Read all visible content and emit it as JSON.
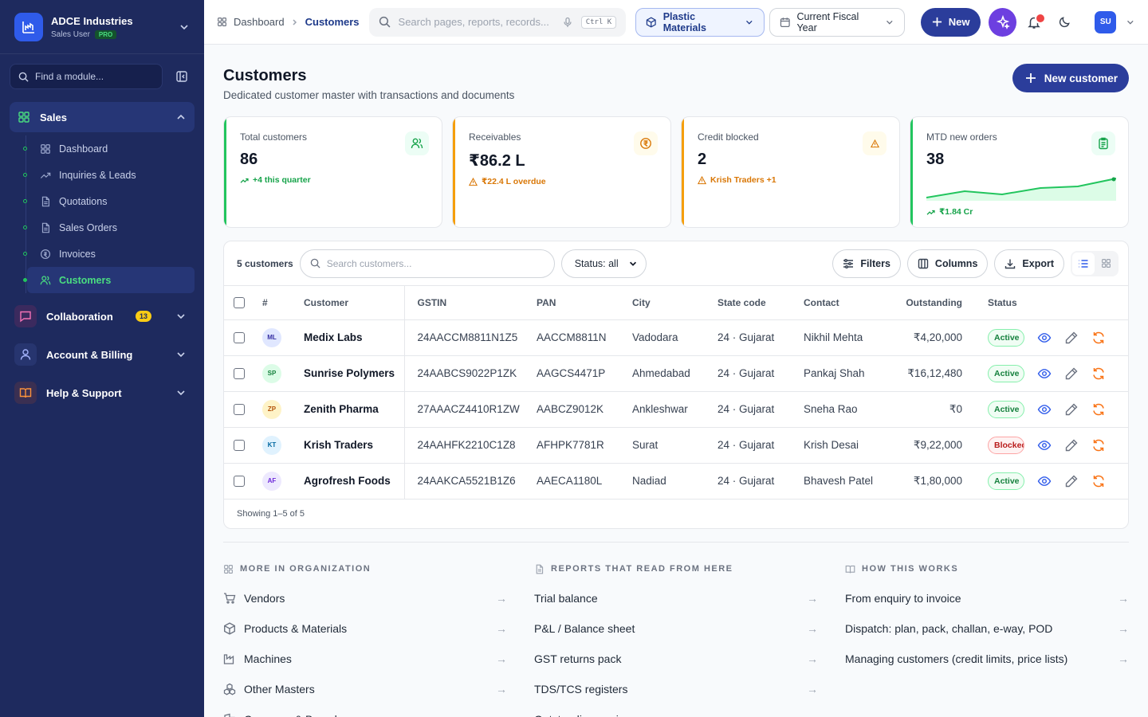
{
  "brand": {
    "name": "ADCE Industries",
    "role": "Sales User",
    "plan": "PRO"
  },
  "sidebar": {
    "find_placeholder": "Find a module...",
    "sales_label": "Sales",
    "sales_items": [
      {
        "label": "Dashboard",
        "icon": "grid-icon"
      },
      {
        "label": "Inquiries & Leads",
        "icon": "trend-icon"
      },
      {
        "label": "Quotations",
        "icon": "doc-icon"
      },
      {
        "label": "Sales Orders",
        "icon": "doc-icon"
      },
      {
        "label": "Invoices",
        "icon": "coin-icon"
      },
      {
        "label": "Customers",
        "icon": "users-icon"
      }
    ],
    "groups": [
      {
        "label": "Collaboration",
        "badge": "13"
      },
      {
        "label": "Account & Billing",
        "badge": ""
      },
      {
        "label": "Help & Support",
        "badge": ""
      }
    ]
  },
  "topbar": {
    "crumb_root": "Dashboard",
    "crumb_current": "Customers",
    "search_placeholder": "Search pages, reports, records...",
    "shortcut": "Ctrl K",
    "org_filter": "Plastic Materials",
    "period": "Current Fiscal Year",
    "new_label": "New",
    "user_initials": "SU"
  },
  "page": {
    "title": "Customers",
    "subtitle": "Dedicated customer master with transactions and documents",
    "new_button": "New customer"
  },
  "stats": [
    {
      "label": "Total customers",
      "value": "86",
      "note": "+4 this quarter",
      "accent": "#22c55e"
    },
    {
      "label": "Receivables",
      "value": "₹86.2 L",
      "note": "₹22.4 L overdue",
      "accent": "#f59e0b"
    },
    {
      "label": "Credit blocked",
      "value": "2",
      "note": "Krish Traders +1",
      "accent": "#f59e0b"
    },
    {
      "label": "MTD new orders",
      "value": "38",
      "note": "₹1.84 Cr",
      "accent": "#22c55e"
    }
  ],
  "table": {
    "count": "5 customers",
    "search_placeholder": "Search customers...",
    "status_filter": "Status: all",
    "filters": "Filters",
    "columns": "Columns",
    "export": "Export",
    "headers": [
      "#",
      "Customer",
      "GSTIN",
      "PAN",
      "City",
      "State code",
      "Contact",
      "Outstanding",
      "Status"
    ],
    "rows": [
      {
        "initials": "ML",
        "name": "Medix Labs",
        "gstin": "24AACCM8811N1Z5",
        "pan": "AACCM8811N",
        "city": "Vadodara",
        "state": "24 · Gujarat",
        "contact": "Nikhil Mehta",
        "outstanding": "₹4,20,000",
        "status": "Active",
        "av_bg": "#e0e7ff",
        "av_fg": "#3730a3"
      },
      {
        "initials": "SP",
        "name": "Sunrise Polymers",
        "gstin": "24AABCS9022P1ZK",
        "pan": "AAGCS4471P",
        "city": "Ahmedabad",
        "state": "24 · Gujarat",
        "contact": "Pankaj Shah",
        "outstanding": "₹16,12,480",
        "status": "Active",
        "av_bg": "#dcfce7",
        "av_fg": "#15803d"
      },
      {
        "initials": "ZP",
        "name": "Zenith Pharma",
        "gstin": "27AAACZ4410R1ZW",
        "pan": "AABCZ9012K",
        "city": "Ankleshwar",
        "state": "24 · Gujarat",
        "contact": "Sneha Rao",
        "outstanding": "₹0",
        "status": "Active",
        "av_bg": "#fef3c7",
        "av_fg": "#b45309"
      },
      {
        "initials": "KT",
        "name": "Krish Traders",
        "gstin": "24AAHFK2210C1Z8",
        "pan": "AFHPK7781R",
        "city": "Surat",
        "state": "24 · Gujarat",
        "contact": "Krish Desai",
        "outstanding": "₹9,22,000",
        "status": "Blocked",
        "av_bg": "#e0f2fe",
        "av_fg": "#0369a1"
      },
      {
        "initials": "AF",
        "name": "Agrofresh Foods",
        "gstin": "24AAKCA5521B1Z6",
        "pan": "AAECA1180L",
        "city": "Nadiad",
        "state": "24 · Gujarat",
        "contact": "Bhavesh Patel",
        "outstanding": "₹1,80,000",
        "status": "Active",
        "av_bg": "#ede9fe",
        "av_fg": "#6d28d9"
      }
    ],
    "showing": "Showing 1–5 of 5"
  },
  "footer_cols": [
    {
      "title": "MORE IN ORGANIZATION",
      "icon": "grid-icon",
      "links": [
        {
          "label": "Vendors",
          "icon": "cart-icon"
        },
        {
          "label": "Products & Materials",
          "icon": "box-icon"
        },
        {
          "label": "Machines",
          "icon": "factory-icon"
        },
        {
          "label": "Other Masters",
          "icon": "cubes-icon"
        },
        {
          "label": "Company & Branches",
          "icon": "building-icon"
        }
      ]
    },
    {
      "title": "REPORTS THAT READ FROM HERE",
      "icon": "doc-icon",
      "links": [
        {
          "label": "Trial balance"
        },
        {
          "label": "P&L / Balance sheet"
        },
        {
          "label": "GST returns pack"
        },
        {
          "label": "TDS/TCS registers"
        },
        {
          "label": "Outstanding ageing"
        }
      ]
    },
    {
      "title": "HOW THIS WORKS",
      "icon": "book-icon",
      "links": [
        {
          "label": "From enquiry to invoice"
        },
        {
          "label": "Dispatch: plan, pack, challan, e-way, POD"
        },
        {
          "label": "Managing customers (credit limits, price lists)"
        }
      ]
    }
  ]
}
